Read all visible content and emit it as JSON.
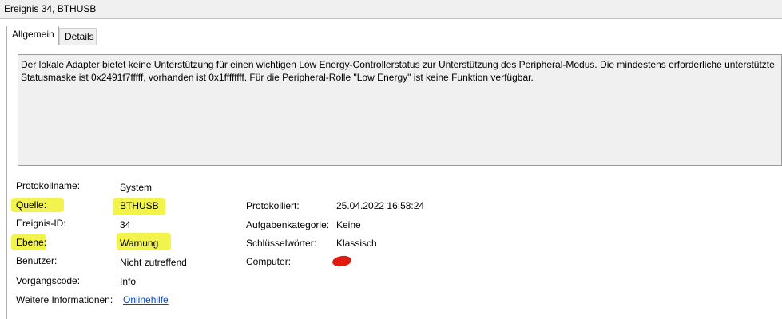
{
  "window": {
    "title": "Ereignis 34, BTHUSB"
  },
  "tabs": [
    {
      "label": "Allgemein",
      "active": true
    },
    {
      "label": "Details",
      "active": false
    }
  ],
  "description": "Der lokale Adapter bietet keine Unterstützung für einen wichtigen Low Energy-Controllerstatus zur Unterstützung des Peripheral-Modus. Die mindestens erforderliche unterstützte Statusmaske ist 0x2491f7fffff, vorhanden ist 0x1ffffffff. Für die Peripheral-Rolle \"Low Energy\" ist keine Funktion verfügbar.",
  "fields": {
    "protokollname": {
      "label": "Protokollname:",
      "value": "System"
    },
    "quelle": {
      "label": "Quelle:",
      "value": "BTHUSB"
    },
    "protokolliert": {
      "label": "Protokolliert:",
      "value": "25.04.2022 16:58:24"
    },
    "ereignis_id": {
      "label": "Ereignis-ID:",
      "value": "34"
    },
    "aufgabenkategorie": {
      "label": "Aufgabenkategorie:",
      "value": "Keine"
    },
    "ebene": {
      "label": "Ebene:",
      "value": "Warnung"
    },
    "schluesselwoerter": {
      "label": "Schlüsselwörter:",
      "value": "Klassisch"
    },
    "benutzer": {
      "label": "Benutzer:",
      "value": "Nicht zutreffend"
    },
    "computer": {
      "label": "Computer:",
      "value": ""
    },
    "vorgangscode": {
      "label": "Vorgangscode:",
      "value": "Info"
    },
    "weitere": {
      "label": "Weitere Informationen:",
      "value": "Onlinehilfe"
    }
  },
  "colors": {
    "highlight": "#f2f23a",
    "redaction": "#e01b0f",
    "link": "#0645c8"
  }
}
